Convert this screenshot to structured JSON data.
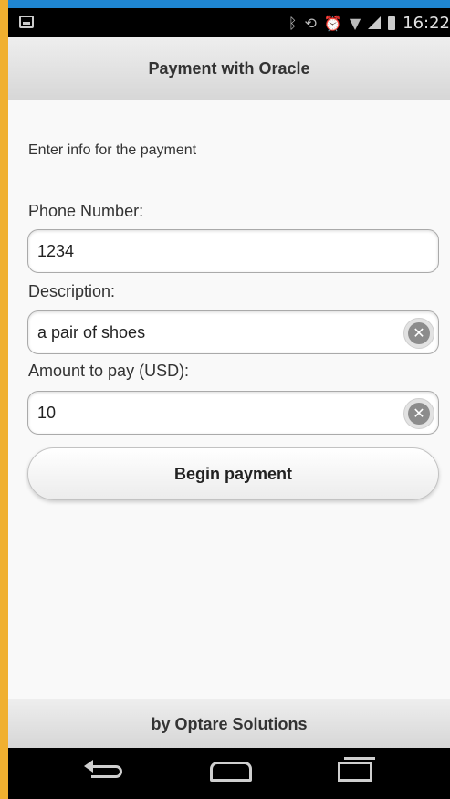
{
  "status_bar": {
    "time": "16:22",
    "icons": [
      "bluetooth-icon",
      "rotate-icon",
      "alarm-icon",
      "wifi-icon",
      "signal-icon",
      "battery-icon"
    ]
  },
  "header": {
    "title": "Payment with Oracle"
  },
  "form": {
    "intro": "Enter info for the payment",
    "phone_label": "Phone Number:",
    "phone_value": "1234",
    "description_label": "Description:",
    "description_value": "a pair of shoes",
    "amount_label": "Amount to pay (USD):",
    "amount_value": "10",
    "clear_glyph": "✕",
    "submit_label": "Begin payment"
  },
  "footer": {
    "text": "by Optare Solutions"
  },
  "colors": {
    "accent_frame": "#f0b030",
    "header_bg": "#e3e3e3",
    "page_bg": "#f9f9f9"
  }
}
